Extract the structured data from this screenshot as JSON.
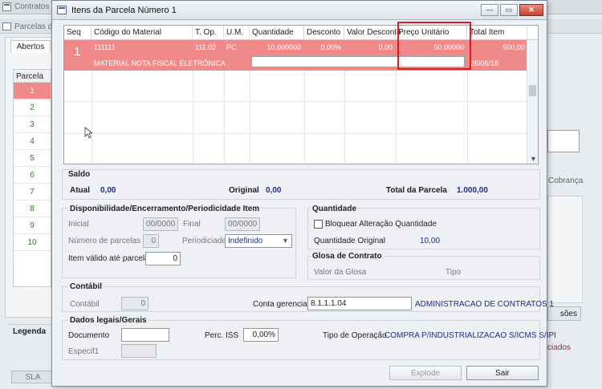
{
  "background": {
    "window_title": "Contratos",
    "subwindow_title": "Parcelas do",
    "tab_open": "Abertos",
    "column_parcela": "Parcela",
    "rows": [
      "1",
      "2",
      "3",
      "4",
      "5",
      "6",
      "7",
      "8",
      "9",
      "10"
    ],
    "legend": "Legenda",
    "sla_button": "SLA",
    "right_label_cobranca": "Cobrança",
    "right_button": "sões",
    "right_link": "ciados"
  },
  "dialog": {
    "title": "Itens da Parcela Número 1",
    "window_buttons": {
      "minimize": "—",
      "restore": "▭",
      "close": "✕"
    },
    "grid": {
      "headers": [
        "Seq",
        "Código do Material",
        "T. Op.",
        "U.M.",
        "Quantidade",
        "Desconto",
        "Valor Desconto",
        "Preço Unitário",
        "Total Item"
      ],
      "row": {
        "seq": "1",
        "codigo": "111111",
        "top": "111.02",
        "um": "PC",
        "quantidade": "10,000000",
        "desconto": "0,00%",
        "valor_desconto": "0,00",
        "preco_unitario": "50,00000",
        "total_item": "500,00",
        "descricao": "MATERIAL NOTA FISCAL ELETRÔNICA",
        "data": "26/06/18"
      }
    },
    "saldo": {
      "title": "Saldo",
      "atual_label": "Atual",
      "atual_value": "0,00",
      "original_label": "Original",
      "original_value": "0,00",
      "total_label": "Total da Parcela",
      "total_value": "1.000,00"
    },
    "disp": {
      "title": "Disponibilidade/Encerramento/Periodicidade Item",
      "inicial_label": "Inicial",
      "inicial_value": "00/0000",
      "final_label": "Final",
      "final_value": "00/0000",
      "numero_label": "Número de parcelas",
      "numero_value": "0",
      "periodicidade_label": "Periodiciade",
      "periodicidade_value": "Indefinido",
      "item_valido_label": "Item válido até parcela",
      "item_valido_value": "0"
    },
    "quantidade": {
      "title": "Quantidade",
      "bloquear_label": "Bloquear Alteração Quantidade",
      "original_label": "Quantidade Original",
      "original_value": "10,00"
    },
    "glosa": {
      "title": "Glosa de Contrato",
      "valor_label": "Valor da Glosa",
      "tipo_label": "Tipo"
    },
    "contabil": {
      "title": "Contábil",
      "contabil_label": "Contábil",
      "contabil_value": "0",
      "conta_label": "Conta gerencial",
      "conta_value": "8.1.1.1.04",
      "conta_desc": "ADMINISTRACAO DE CONTRATOS 1"
    },
    "dados": {
      "title": "Dados legais/Gerais",
      "documento_label": "Documento",
      "documento_value": "",
      "perc_iss_label": "Perc. ISS",
      "perc_iss_value": "0,00%",
      "tipo_op_label": "Tipo de Operação",
      "tipo_op_value": "COMPRA P/INDUSTRIALIZACAO S/ICMS S/IPI",
      "especif_label": "Especif1",
      "especif_value": ""
    },
    "buttons": {
      "explode": "Explode",
      "sair": "Sair"
    }
  }
}
